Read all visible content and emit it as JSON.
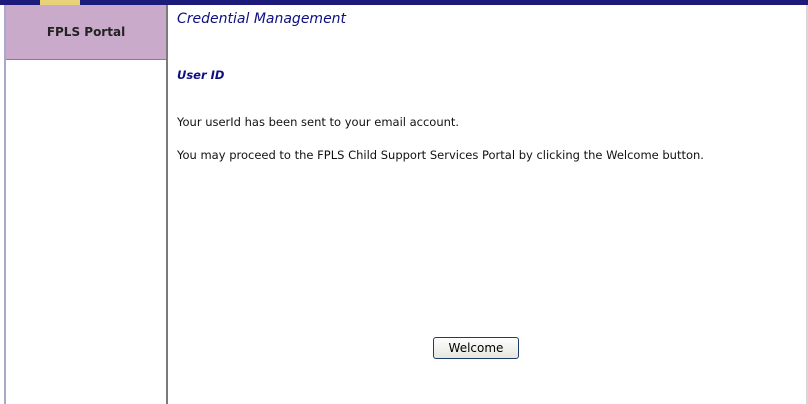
{
  "sidebar": {
    "portal_label": "FPLS Portal"
  },
  "main": {
    "title": "Credential Management",
    "section_title": "User ID",
    "message_sent": "Your userId has been sent to your email account.",
    "message_proceed": "You may proceed to the FPLS Child Support Services Portal by clicking the Welcome button.",
    "welcome_button": "Welcome"
  },
  "colors": {
    "header_band": "#1c1a7a",
    "sidebar_tab": "#caaacb",
    "title_text": "#0f0f80"
  },
  "icons": {
    "header_logo": "logo-sliver"
  }
}
